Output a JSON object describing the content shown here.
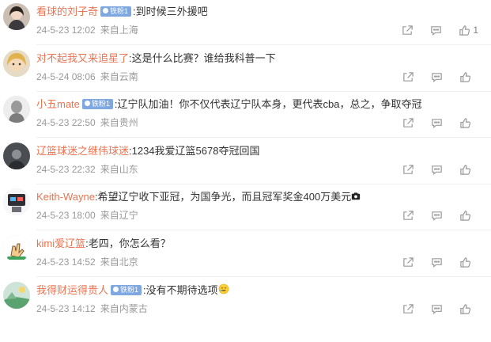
{
  "colors": {
    "username": "#eb7350",
    "text": "#333333",
    "meta": "#999999",
    "badge": "#7fa8e0"
  },
  "comments": [
    {
      "username": "看球的刘子奇",
      "badge": "铁粉1",
      "text": ":到时候三外援吧",
      "time": "24-5-23 12:02",
      "location": "来自上海",
      "likes": "1",
      "avatar_icon": "girl-portrait-avatar"
    },
    {
      "username": "对不起我又来追星了",
      "badge": "",
      "text": ":这是什么比赛？谁给我科普一下",
      "time": "24-5-24 08:06",
      "location": "来自云南",
      "likes": "",
      "avatar_icon": "blonde-child-avatar"
    },
    {
      "username": "小五mate",
      "badge": "铁粉1",
      "text": ":辽宁队加油！你不仅代表辽宁队本身，更代表cba，总之，争取夺冠",
      "time": "24-5-23 22:50",
      "location": "来自贵州",
      "likes": "",
      "avatar_icon": "bust-statue-avatar"
    },
    {
      "username": "辽篮球迷之继伟球迷",
      "badge": "",
      "text": ":1234我爱辽篮5678夺冠回国",
      "time": "24-5-23 22:32",
      "location": "来自山东",
      "likes": "",
      "avatar_icon": "dark-photo-avatar"
    },
    {
      "username": "Keith-Wayne",
      "badge": "",
      "text": ":希望辽宁收下亚冠，为国争光，而且冠军奖金400万美元",
      "time": "24-5-23 18:00",
      "location": "来自辽宁",
      "likes": "",
      "avatar_icon": "robot-avatar"
    },
    {
      "username": "kimi爱辽篮",
      "badge": "",
      "text": ":老四，你怎么看？",
      "time": "24-5-23 14:52",
      "location": "来自北京",
      "likes": "",
      "avatar_icon": "cartoon-hand-avatar"
    },
    {
      "username": "我得财运得贵人",
      "badge": "铁粉1",
      "text": ":没有不期待选项",
      "time": "24-5-23 14:12",
      "location": "来自内蒙古",
      "likes": "",
      "avatar_icon": "green-landscape-avatar"
    }
  ]
}
